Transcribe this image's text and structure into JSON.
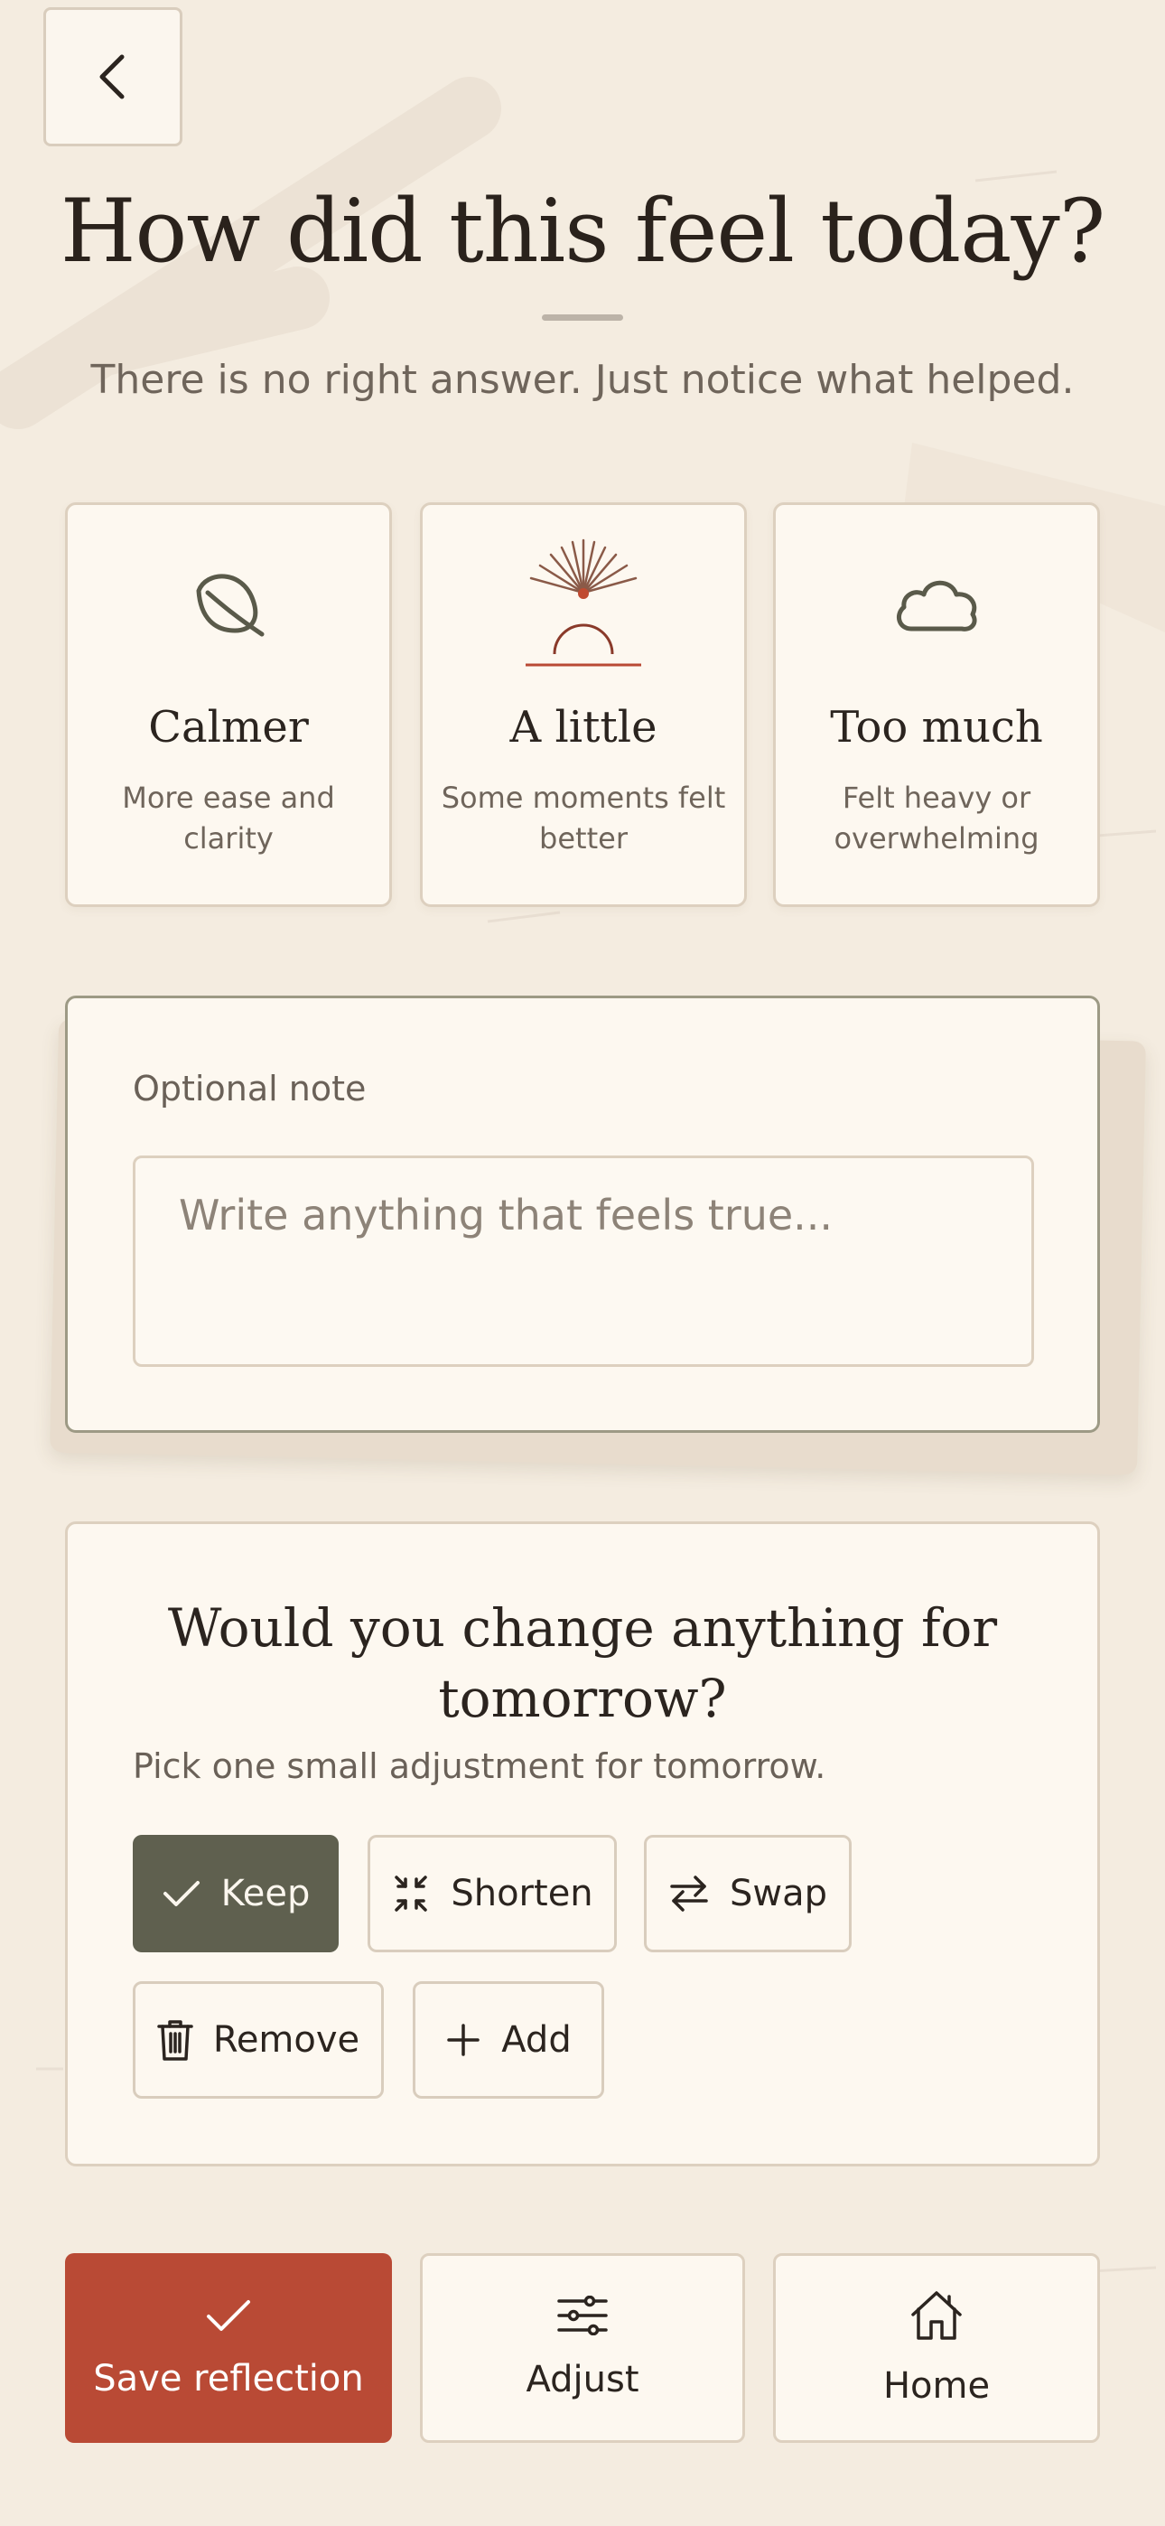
{
  "header": {
    "back_label": "Back",
    "title": "How did this feel today?",
    "subtitle": "There is no right answer. Just notice what helped."
  },
  "moods": [
    {
      "label": "Calmer",
      "desc": "More ease and clarity",
      "icon": "leaf-icon"
    },
    {
      "label": "A little",
      "desc": "Some moments felt better",
      "icon": "sunrise-icon"
    },
    {
      "label": "Too much",
      "desc": "Felt heavy or overwhelming",
      "icon": "cloud-icon"
    }
  ],
  "note": {
    "label": "Optional note",
    "placeholder": "Write anything that feels true..."
  },
  "adjust": {
    "title": "Would you change anything for tomorrow?",
    "subtitle": "Pick one small adjustment for tomorrow.",
    "options": [
      {
        "label": "Keep",
        "icon": "check-icon",
        "selected": true
      },
      {
        "label": "Shorten",
        "icon": "shrink-icon",
        "selected": false
      },
      {
        "label": "Swap",
        "icon": "swap-icon",
        "selected": false
      },
      {
        "label": "Remove",
        "icon": "trash-icon",
        "selected": false
      },
      {
        "label": "Add",
        "icon": "plus-icon",
        "selected": false
      }
    ]
  },
  "actions": {
    "save": "Save reflection",
    "adjust": "Adjust",
    "home": "Home"
  },
  "colors": {
    "background": "#f4ece0",
    "card": "#fdf8f0",
    "accent": "#b94a35",
    "selected_chip": "#5f604f",
    "text": "#2b241f",
    "muted_text": "#6f655b"
  }
}
